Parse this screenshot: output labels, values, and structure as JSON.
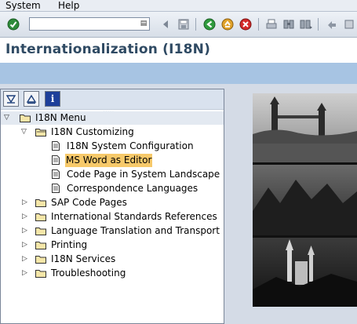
{
  "menubar": {
    "items": [
      "System",
      "Help"
    ]
  },
  "toolbar": {
    "command_value": "",
    "icons": [
      "enter-checkmark-icon",
      "back-icon",
      "save-icon",
      "back-green-icon",
      "exit-icon",
      "cancel-icon",
      "print-icon",
      "find-icon",
      "find-next-icon",
      "first-page-icon"
    ]
  },
  "page": {
    "title": "Internationalization (I18N)"
  },
  "tree": {
    "toolbar_buttons": [
      "expand-subtree-icon",
      "collapse-subtree-icon",
      "info-icon"
    ],
    "splitter": ".....",
    "nodes": [
      {
        "label": "I18N Menu"
      },
      {
        "label": "I18N Customizing"
      },
      {
        "label": "I18N System Configuration"
      },
      {
        "label": "MS Word as Editor"
      },
      {
        "label": "Code Page in System Landscape (R"
      },
      {
        "label": "Correspondence Languages"
      },
      {
        "label": "SAP Code Pages"
      },
      {
        "label": "International Standards References"
      },
      {
        "label": "Language Translation and Transport"
      },
      {
        "label": "Printing"
      },
      {
        "label": "I18N Services"
      },
      {
        "label": "Troubleshooting"
      }
    ]
  },
  "colors": {
    "title": "#2f4a63",
    "band": "#a7c4e3",
    "highlight": "#f7c96a",
    "folder": "#e8c65a"
  }
}
